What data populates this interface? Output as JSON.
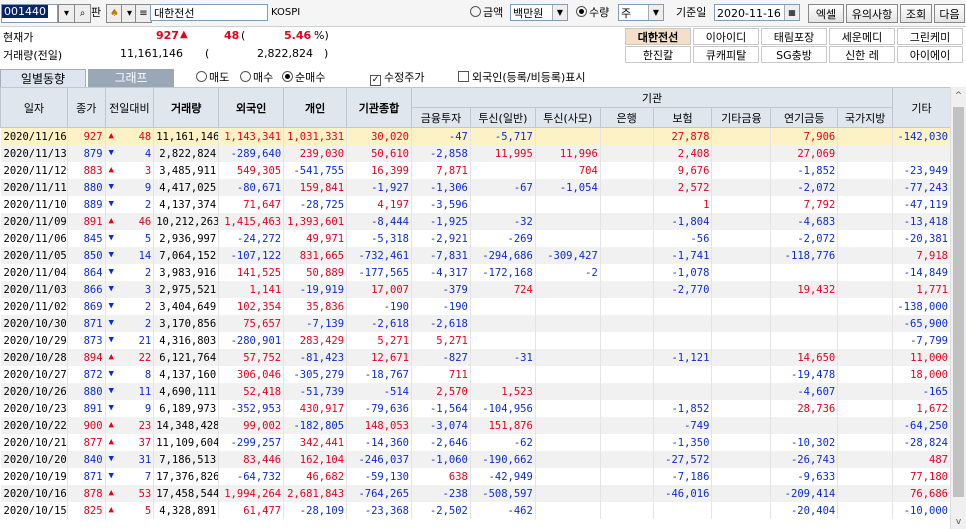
{
  "toolbar": {
    "code": "001440",
    "pan_label": "판",
    "stock_name": "대한전선",
    "market": "KOSPI",
    "amount_label": "금액",
    "unit": "백만원",
    "qty_label": "수량",
    "qty_unit": "주",
    "base_date_label": "기준일",
    "base_date": "2020-11-16",
    "excel": "엑셀",
    "notice": "유의사항",
    "query": "조회",
    "next": "다음"
  },
  "info": {
    "cur_label": "현재가",
    "cur_price": "927",
    "change": "48",
    "paren_open": "(",
    "pct": "5.46",
    "pct_suffix": "%)",
    "vol_label": "거래량(전일)",
    "volume": "11,161,146",
    "prev_volume": "2,822,824",
    "prev_close": ")"
  },
  "related": [
    "대한전선",
    "이아이디",
    "태림포장",
    "세운메디",
    "그린케미",
    "한진칼",
    "큐캐피탈",
    "SG충방",
    "신한 레",
    "아이에이"
  ],
  "tabs": {
    "daily": "일별동향",
    "graph": "그래프"
  },
  "options": {
    "sell": "매도",
    "buy": "매수",
    "net": "순매수",
    "adj": "수정주가",
    "foreign": "외국인(등록/비등록)표시"
  },
  "colors": {
    "up": "#e8001b",
    "down": "#0a2bd8",
    "highlight": "#fdf2c6"
  },
  "columns": [
    "일자",
    "종가",
    "전일대비",
    "거래량",
    "외국인",
    "개인",
    "기관종합",
    "기관",
    "금융투자",
    "투신(일반)",
    "투신(사모)",
    "은행",
    "보험",
    "기타금융",
    "연기금등",
    "국가지방",
    "기타"
  ],
  "rows": [
    [
      "2020/11/16",
      "927",
      "up",
      "48",
      "11,161,146",
      "1,143,341",
      "1,031,331",
      "30,020",
      "-47",
      "-5,717",
      "",
      "",
      "27,878",
      "",
      "7,906",
      "",
      "-142,030"
    ],
    [
      "2020/11/13",
      "879",
      "dn",
      "4",
      "2,822,824",
      "-289,640",
      "239,030",
      "50,610",
      "-2,858",
      "11,995",
      "11,996",
      "",
      "2,408",
      "",
      "27,069",
      "",
      ""
    ],
    [
      "2020/11/12",
      "883",
      "up",
      "3",
      "3,485,911",
      "549,305",
      "-541,755",
      "16,399",
      "7,871",
      "",
      "704",
      "",
      "9,676",
      "",
      "-1,852",
      "",
      "-23,949"
    ],
    [
      "2020/11/11",
      "880",
      "dn",
      "9",
      "4,417,025",
      "-80,671",
      "159,841",
      "-1,927",
      "-1,306",
      "-67",
      "-1,054",
      "",
      "2,572",
      "",
      "-2,072",
      "",
      "-77,243"
    ],
    [
      "2020/11/10",
      "889",
      "dn",
      "2",
      "4,137,374",
      "71,647",
      "-28,725",
      "4,197",
      "-3,596",
      "",
      "",
      "",
      "1",
      "",
      "7,792",
      "",
      "-47,119"
    ],
    [
      "2020/11/09",
      "891",
      "up",
      "46",
      "10,212,263",
      "1,415,463",
      "1,393,601",
      "-8,444",
      "-1,925",
      "-32",
      "",
      "",
      "-1,804",
      "",
      "-4,683",
      "",
      "-13,418"
    ],
    [
      "2020/11/06",
      "845",
      "dn",
      "5",
      "2,936,997",
      "-24,272",
      "49,971",
      "-5,318",
      "-2,921",
      "-269",
      "",
      "",
      "-56",
      "",
      "-2,072",
      "",
      "-20,381"
    ],
    [
      "2020/11/05",
      "850",
      "dn",
      "14",
      "7,064,152",
      "-107,122",
      "831,665",
      "-732,461",
      "-7,831",
      "-294,686",
      "-309,427",
      "",
      "-1,741",
      "",
      "-118,776",
      "",
      "7,918"
    ],
    [
      "2020/11/04",
      "864",
      "dn",
      "2",
      "3,983,916",
      "141,525",
      "50,889",
      "-177,565",
      "-4,317",
      "-172,168",
      "-2",
      "",
      "-1,078",
      "",
      "",
      "",
      "-14,849"
    ],
    [
      "2020/11/03",
      "866",
      "dn",
      "3",
      "2,975,521",
      "1,141",
      "-19,919",
      "17,007",
      "-379",
      "724",
      "",
      "",
      "-2,770",
      "",
      "19,432",
      "",
      "1,771"
    ],
    [
      "2020/11/02",
      "869",
      "dn",
      "2",
      "3,404,649",
      "102,354",
      "35,836",
      "-190",
      "-190",
      "",
      "",
      "",
      "",
      "",
      "",
      "",
      "-138,000"
    ],
    [
      "2020/10/30",
      "871",
      "dn",
      "2",
      "3,170,856",
      "75,657",
      "-7,139",
      "-2,618",
      "-2,618",
      "",
      "",
      "",
      "",
      "",
      "",
      "",
      "-65,900"
    ],
    [
      "2020/10/29",
      "873",
      "dn",
      "21",
      "4,316,803",
      "-280,901",
      "283,429",
      "5,271",
      "5,271",
      "",
      "",
      "",
      "",
      "",
      "",
      "",
      "-7,799"
    ],
    [
      "2020/10/28",
      "894",
      "up",
      "22",
      "6,121,764",
      "57,752",
      "-81,423",
      "12,671",
      "-827",
      "-31",
      "",
      "",
      "-1,121",
      "",
      "14,650",
      "",
      "11,000"
    ],
    [
      "2020/10/27",
      "872",
      "dn",
      "8",
      "4,137,160",
      "306,046",
      "-305,279",
      "-18,767",
      "711",
      "",
      "",
      "",
      "",
      "",
      "-19,478",
      "",
      "18,000"
    ],
    [
      "2020/10/26",
      "880",
      "dn",
      "11",
      "4,690,111",
      "52,418",
      "-51,739",
      "-514",
      "2,570",
      "1,523",
      "",
      "",
      "",
      "",
      "-4,607",
      "",
      "-165"
    ],
    [
      "2020/10/23",
      "891",
      "dn",
      "9",
      "6,189,973",
      "-352,953",
      "430,917",
      "-79,636",
      "-1,564",
      "-104,956",
      "",
      "",
      "-1,852",
      "",
      "28,736",
      "",
      "1,672"
    ],
    [
      "2020/10/22",
      "900",
      "up",
      "23",
      "14,348,428",
      "99,002",
      "-182,805",
      "148,053",
      "-3,074",
      "151,876",
      "",
      "",
      "-749",
      "",
      "",
      "",
      "-64,250"
    ],
    [
      "2020/10/21",
      "877",
      "up",
      "37",
      "11,109,604",
      "-299,257",
      "342,441",
      "-14,360",
      "-2,646",
      "-62",
      "",
      "",
      "-1,350",
      "",
      "-10,302",
      "",
      "-28,824"
    ],
    [
      "2020/10/20",
      "840",
      "dn",
      "31",
      "7,186,513",
      "83,446",
      "162,104",
      "-246,037",
      "-1,060",
      "-190,662",
      "",
      "",
      "-27,572",
      "",
      "-26,743",
      "",
      "487"
    ],
    [
      "2020/10/19",
      "871",
      "dn",
      "7",
      "17,376,826",
      "-64,732",
      "46,682",
      "-59,130",
      "638",
      "-42,949",
      "",
      "",
      "-7,186",
      "",
      "-9,633",
      "",
      "77,180"
    ],
    [
      "2020/10/16",
      "878",
      "up",
      "53",
      "17,458,544",
      "1,994,264",
      "2,681,843",
      "-764,265",
      "-238",
      "-508,597",
      "",
      "",
      "-46,016",
      "",
      "-209,414",
      "",
      "76,686"
    ],
    [
      "2020/10/15",
      "825",
      "up",
      "5",
      "4,328,891",
      "61,477",
      "-28,109",
      "-23,368",
      "-2,502",
      "-462",
      "",
      "",
      "",
      "",
      "-20,404",
      "",
      "-10,000"
    ]
  ]
}
